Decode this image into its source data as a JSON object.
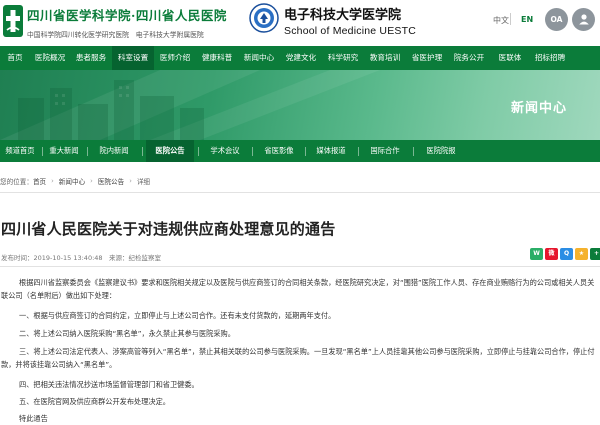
{
  "header": {
    "hospital_name": "四川省医学科学院·四川省人民医院",
    "hospital_sub": "中国科学院四川转化医学研究医院　电子科技大学附属医院",
    "university_name": "电子科技大学医学院",
    "university_en": "School of Medicine UESTC",
    "lang_zh": "中文",
    "lang_en": "EN",
    "oa_label": "OA",
    "icons": {
      "hospital_logo": "hospital-cross-logo",
      "university_logo": "university-seal-logo",
      "user": "user-icon"
    },
    "colors": {
      "brand_green": "#0b7c3a",
      "nav_active": "#066330",
      "circle_gray": "#8d959c"
    }
  },
  "main_nav": [
    "首页",
    "医院概况",
    "患者服务",
    "科室设置",
    "医师介绍",
    "健康科普",
    "新闻中心",
    "党建文化",
    "科学研究",
    "教育培训",
    "省医护理",
    "院务公开",
    "医联体",
    "招标招聘"
  ],
  "main_nav_active": "科室设置",
  "banner": {
    "title": "新闻中心"
  },
  "sub_nav": [
    "频道首页",
    "重大新闻",
    "院内新闻",
    "医院公告",
    "学术会议",
    "省医影像",
    "媒体报道",
    "国际合作",
    "医院院报"
  ],
  "sub_nav_active": "医院公告",
  "breadcrumb": {
    "prefix": "您的位置：",
    "items": [
      "首页",
      "新闻中心",
      "医院公告",
      "详细"
    ]
  },
  "article": {
    "title": "四川省人民医院关于对违规供应商处理意见的通告",
    "meta": "发布时间：2019-10-15 13:40:48　来源：纪检监察室",
    "share_icons": [
      "wechat-icon",
      "weibo-icon",
      "qq-icon",
      "qzone-icon",
      "more-share-icon"
    ],
    "paragraphs": [
      "根据四川省监察委员会《监察建议书》要求和医院相关规定以及医院与供应商签订的合同相关条款，经医院研究决定，对“围猎”医院工作人员、存在商业贿赂行为的公司或相关人员关联公司（名单附后）做出如下处理：",
      "一、根据与供应商签订的合同约定，立即停止与上述公司合作。还有未支付货款的，延期两年支付。",
      "二、将上述公司纳入医院采购“黑名单”，永久禁止其参与医院采购。",
      "三、将上述公司法定代表人、涉案高管等列入“黑名单”，禁止其相关联的公司参与医院采购。一旦发现“黑名单”上人员挂靠其他公司参与医院采购，立即停止与挂靠公司合作，停止付款，并将该挂靠公司纳入“黑名单”。",
      "四、把相关违法情况抄送市场监督管理部门和省卫健委。",
      "五、在医院官网及供应商群公开发布处理决定。",
      "特此通告"
    ]
  }
}
